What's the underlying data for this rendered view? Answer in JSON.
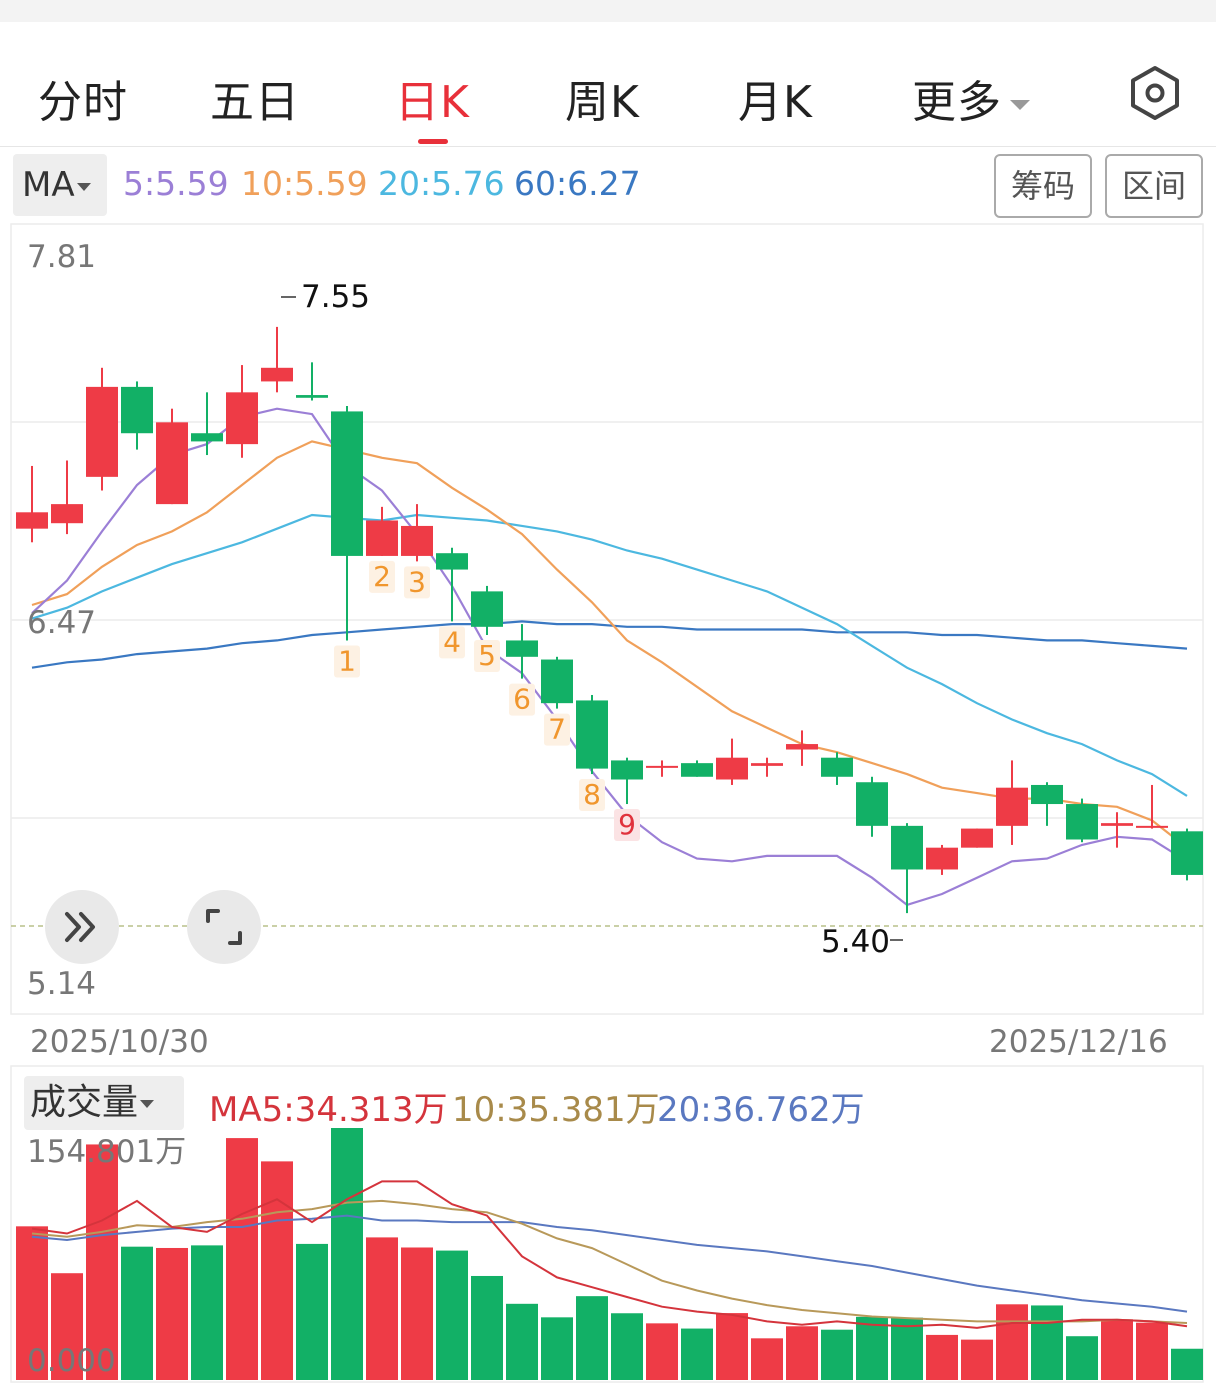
{
  "tabs": [
    {
      "label": "分时",
      "active": false
    },
    {
      "label": "五日",
      "active": false
    },
    {
      "label": "日K",
      "active": true
    },
    {
      "label": "周K",
      "active": false
    },
    {
      "label": "月K",
      "active": false
    },
    {
      "label": "更多",
      "active": false
    }
  ],
  "ma_bar": {
    "selector_label": "MA",
    "ma5": "5:5.59",
    "ma10": "10:5.59",
    "ma20": "20:5.76",
    "ma60": "60:6.27",
    "button_chip": "筹码",
    "button_range": "区间"
  },
  "price_axis": {
    "top": "7.81",
    "mid": "6.47",
    "bottom": "5.14"
  },
  "high_label": "7.55",
  "low_label": "5.40",
  "date_start": "2025/10/30",
  "date_end": "2025/12/16",
  "volume_bar": {
    "selector_label": "成交量",
    "ma5": "MA5:34.313万",
    "ma10": "10:35.381万",
    "ma20": "20:36.762万",
    "max_label": "154.801万",
    "zero_label": "0.000"
  },
  "colors": {
    "up": "#ee3b46",
    "down": "#12b066",
    "ma5": "#9b7fd6",
    "ma10": "#f0a05a",
    "ma20": "#4cb8e0",
    "ma60": "#3a78c2",
    "active_tab": "#e8303a"
  },
  "chart_data": {
    "type": "candlestick",
    "price_range": [
      5.14,
      7.81
    ],
    "candles": [
      {
        "o": 6.81,
        "c": 6.87,
        "h": 7.04,
        "l": 6.76
      },
      {
        "o": 6.83,
        "c": 6.9,
        "h": 7.06,
        "l": 6.79
      },
      {
        "o": 7.0,
        "c": 7.33,
        "h": 7.4,
        "l": 6.95
      },
      {
        "o": 7.33,
        "c": 7.16,
        "h": 7.35,
        "l": 7.1
      },
      {
        "o": 6.9,
        "c": 7.2,
        "h": 7.25,
        "l": 6.9
      },
      {
        "o": 7.16,
        "c": 7.13,
        "h": 7.31,
        "l": 7.08
      },
      {
        "o": 7.12,
        "c": 7.31,
        "h": 7.41,
        "l": 7.07
      },
      {
        "o": 7.35,
        "c": 7.4,
        "h": 7.55,
        "l": 7.31
      },
      {
        "o": 7.3,
        "c": 7.29,
        "h": 7.42,
        "l": 7.28
      },
      {
        "o": 7.24,
        "c": 6.71,
        "h": 7.26,
        "l": 6.4
      },
      {
        "o": 6.71,
        "c": 6.84,
        "h": 6.89,
        "l": 6.71
      },
      {
        "o": 6.71,
        "c": 6.82,
        "h": 6.9,
        "l": 6.69
      },
      {
        "o": 6.72,
        "c": 6.66,
        "h": 6.74,
        "l": 6.47
      },
      {
        "o": 6.58,
        "c": 6.45,
        "h": 6.6,
        "l": 6.42
      },
      {
        "o": 6.4,
        "c": 6.34,
        "h": 6.46,
        "l": 6.26
      },
      {
        "o": 6.33,
        "c": 6.17,
        "h": 6.34,
        "l": 6.15
      },
      {
        "o": 6.18,
        "c": 5.93,
        "h": 6.2,
        "l": 5.91
      },
      {
        "o": 5.96,
        "c": 5.89,
        "h": 5.97,
        "l": 5.8
      },
      {
        "o": 5.94,
        "c": 5.94,
        "h": 5.96,
        "l": 5.9
      },
      {
        "o": 5.95,
        "c": 5.9,
        "h": 5.96,
        "l": 5.9
      },
      {
        "o": 5.89,
        "c": 5.97,
        "h": 6.04,
        "l": 5.87
      },
      {
        "o": 5.94,
        "c": 5.95,
        "h": 5.97,
        "l": 5.9
      },
      {
        "o": 6.0,
        "c": 6.02,
        "h": 6.07,
        "l": 5.94
      },
      {
        "o": 5.97,
        "c": 5.9,
        "h": 5.99,
        "l": 5.87
      },
      {
        "o": 5.88,
        "c": 5.72,
        "h": 5.9,
        "l": 5.68
      },
      {
        "o": 5.72,
        "c": 5.56,
        "h": 5.73,
        "l": 5.4
      },
      {
        "o": 5.56,
        "c": 5.64,
        "h": 5.65,
        "l": 5.54
      },
      {
        "o": 5.64,
        "c": 5.71,
        "h": 5.71,
        "l": 5.64
      },
      {
        "o": 5.72,
        "c": 5.86,
        "h": 5.96,
        "l": 5.65
      },
      {
        "o": 5.87,
        "c": 5.8,
        "h": 5.88,
        "l": 5.72
      },
      {
        "o": 5.8,
        "c": 5.67,
        "h": 5.82,
        "l": 5.66
      },
      {
        "o": 5.72,
        "c": 5.73,
        "h": 5.77,
        "l": 5.64
      },
      {
        "o": 5.72,
        "c": 5.72,
        "h": 5.87,
        "l": 5.71
      },
      {
        "o": 5.7,
        "c": 5.54,
        "h": 5.71,
        "l": 5.52
      }
    ],
    "ma5": [
      6.5,
      6.62,
      6.8,
      6.97,
      7.08,
      7.12,
      7.22,
      7.25,
      7.23,
      7.04,
      6.95,
      6.79,
      6.6,
      6.37,
      6.28,
      6.11,
      5.92,
      5.76,
      5.66,
      5.6,
      5.59,
      5.61,
      5.61,
      5.61,
      5.53,
      5.43,
      5.47,
      5.53,
      5.59,
      5.6,
      5.65,
      5.68,
      5.67,
      5.59
    ],
    "ma10": [
      6.53,
      6.57,
      6.67,
      6.75,
      6.8,
      6.87,
      6.97,
      7.07,
      7.13,
      7.1,
      7.07,
      7.05,
      6.96,
      6.88,
      6.79,
      6.66,
      6.54,
      6.4,
      6.32,
      6.23,
      6.14,
      6.08,
      6.02,
      5.99,
      5.95,
      5.91,
      5.86,
      5.84,
      5.82,
      5.82,
      5.8,
      5.79,
      5.74,
      5.64
    ],
    "ma20": [
      6.48,
      6.52,
      6.58,
      6.63,
      6.68,
      6.72,
      6.76,
      6.81,
      6.86,
      6.85,
      6.84,
      6.86,
      6.85,
      6.84,
      6.82,
      6.8,
      6.77,
      6.73,
      6.7,
      6.66,
      6.62,
      6.58,
      6.52,
      6.46,
      6.38,
      6.3,
      6.24,
      6.17,
      6.11,
      6.06,
      6.02,
      5.96,
      5.91,
      5.83
    ],
    "ma60": [
      6.3,
      6.32,
      6.33,
      6.35,
      6.36,
      6.37,
      6.39,
      6.4,
      6.42,
      6.43,
      6.44,
      6.45,
      6.46,
      6.46,
      6.47,
      6.46,
      6.46,
      6.45,
      6.45,
      6.44,
      6.44,
      6.44,
      6.44,
      6.43,
      6.43,
      6.43,
      6.42,
      6.42,
      6.41,
      6.4,
      6.4,
      6.39,
      6.38,
      6.37
    ],
    "td_sequence": [
      "",
      "",
      "",
      "",
      "",
      "",
      "",
      "",
      "",
      "1",
      "2",
      "3",
      "4",
      "5",
      "6",
      "7",
      "8",
      "9",
      "",
      "",
      "",
      "",
      "",
      "",
      "",
      "",
      "",
      "",
      "",
      "",
      "",
      "",
      "",
      ""
    ],
    "volume_range": [
      0,
      154.801
    ],
    "volume": [
      94.4,
      65.6,
      144.7,
      81.9,
      81.1,
      82.7,
      148.6,
      134.3,
      83.6,
      154.8,
      87.6,
      81.4,
      79.5,
      63.9,
      46.8,
      38.5,
      51.5,
      41.0,
      34.8,
      31.6,
      41.1,
      25.6,
      33.0,
      30.9,
      38.8,
      38.3,
      27.7,
      24.8,
      46.5,
      45.8,
      26.9,
      37.3,
      35.2,
      19.2
    ],
    "vol_ma5": [
      93,
      90,
      98,
      110,
      94,
      91,
      102,
      111,
      97,
      111,
      122,
      122,
      108,
      101,
      76,
      63,
      57,
      51,
      45,
      42,
      40,
      36,
      34,
      36,
      34,
      33,
      34,
      32,
      35,
      35,
      37,
      37,
      36,
      33
    ],
    "vol_ma10": [
      90,
      88,
      91,
      95,
      94,
      97,
      99,
      103,
      105,
      109,
      110,
      108,
      105,
      103,
      96,
      87,
      81,
      71,
      61,
      55,
      50,
      46,
      43,
      41,
      39,
      38,
      37,
      36,
      36,
      36,
      36,
      37,
      36,
      35
    ],
    "vol_ma20": [
      88,
      86,
      89,
      91,
      93,
      94,
      94,
      98,
      99,
      101,
      98,
      98,
      97,
      97,
      97,
      94,
      92,
      89,
      86,
      83,
      81,
      79,
      76,
      73,
      70,
      66,
      62,
      58,
      55,
      52,
      49,
      47,
      45,
      42
    ]
  }
}
